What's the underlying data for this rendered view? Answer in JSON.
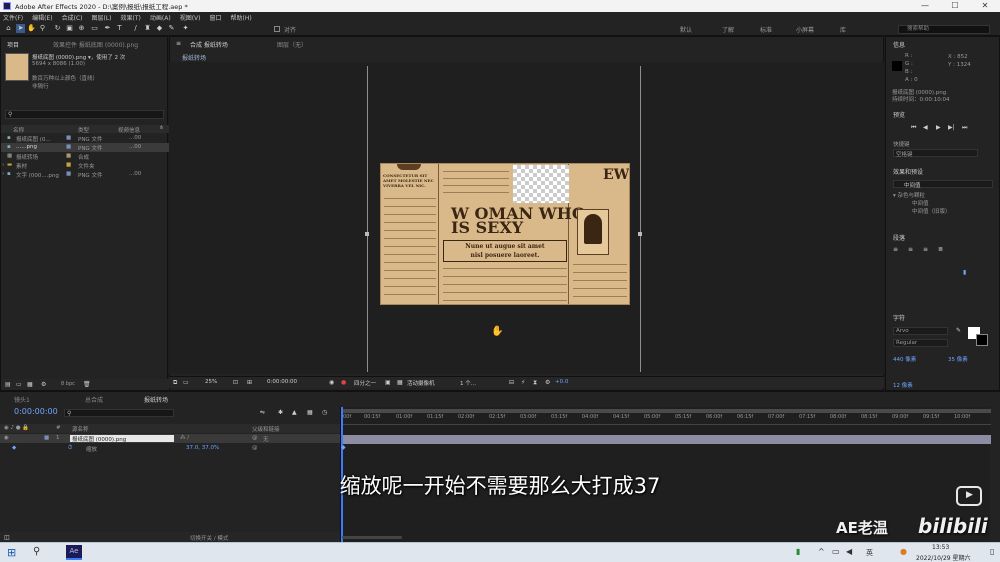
{
  "window": {
    "title": "Adobe After Effects 2020 - D:\\案例\\报纸\\报纸工程.aep *",
    "controls": [
      "—",
      "☐",
      "✕"
    ]
  },
  "menu": [
    "文件(F)",
    "编辑(E)",
    "合成(C)",
    "图层(L)",
    "效果(T)",
    "动画(A)",
    "视图(V)",
    "窗口",
    "帮助(H)"
  ],
  "toolbar": {
    "snap_label": "对齐",
    "workspaces": [
      "默认",
      "了解",
      "标准",
      "小屏幕",
      "库"
    ],
    "search_placeholder": "搜索帮助"
  },
  "project": {
    "tab_project": "项目",
    "tab_effects": "效果控件 报纸底图 (0000).png",
    "preview_name": "报纸底图 (0000).png ▾，使用了 2 次",
    "preview_size": "5694 x 8086 (1.00)",
    "preview_colors": "数百万种以上颜色（直线）",
    "preview_interp": "非隔行",
    "search_placeholder": "",
    "cols": [
      "名称",
      "类型",
      "视频信息"
    ],
    "items": [
      {
        "name": "报纸底图 (0...",
        "type": "PNG 文件",
        "info": "...00"
      },
      {
        "name": "......png",
        "type": "PNG 文件",
        "info": "...00"
      },
      {
        "name": "报纸转场",
        "type": "合成",
        "info": ""
      },
      {
        "name": "素材",
        "type": "文件夹",
        "info": ""
      },
      {
        "name": "文字 (000....png",
        "type": "PNG 文件",
        "info": "...00"
      }
    ],
    "bpc": "8 bpc"
  },
  "comp": {
    "tab": "合成 报纸转场",
    "layer_tab": "图层（无）",
    "sub_tab": "报纸转场",
    "zoom": "25%",
    "timecode": "0:00:00:00",
    "quality": "四分之一",
    "camera": "活动摄像机",
    "views": "1 个...",
    "exposure": "+0.0"
  },
  "newspaper": {
    "h_left": "CONSECTETUR SIT AMET MOLESTIE NEC VIVERRA VEL NIC.",
    "h_main1": "W OMAN WHO",
    "h_main2": "IS SEXY",
    "sub1": "Nune ut augue sit amet",
    "sub2": "nisl posuere laoreet.",
    "corner": "EWS"
  },
  "right": {
    "info": "信息",
    "info_x": "X : 852",
    "info_y": "Y : 1324",
    "info_r": "R :",
    "info_g": "G :",
    "info_b": "B :",
    "info_a": "A : 0",
    "info_layer": "报纸底图 (0000).png",
    "info_time": "持续时间：0:00:10:04",
    "preview": "预览",
    "shortcut": "快捷键",
    "shortcut_val": "空格键",
    "effects": "效果和预设",
    "effects_search": "中间值",
    "effects_group": "▾ 杂色与颗粒",
    "effects_item1": "中间值",
    "effects_item2": "中间值（旧版）",
    "align": "段落",
    "char": "字符",
    "font": "Arvo",
    "style": "Regular",
    "size": "440 像素",
    "leading": "35 像素",
    "kern": "12 像素"
  },
  "timeline": {
    "tabs": [
      "镜头1",
      "总合成",
      "报纸转场"
    ],
    "timecode": "0:00:00:00",
    "cols": [
      "#",
      "源名称",
      "父级和链接"
    ],
    "layer_num": "1",
    "layer_name": "报纸底图 (0000).png",
    "parent": "无",
    "prop_name": "缩放",
    "prop_value": "37.0, 37.0%",
    "ruler": [
      "00f",
      "00:15f",
      "01:00f",
      "01:15f",
      "02:00f",
      "02:15f",
      "03:00f",
      "03:15f",
      "04:00f",
      "04:15f",
      "05:00f",
      "05:15f",
      "06:00f",
      "06:15f",
      "07:00f",
      "07:15f",
      "08:00f",
      "08:15f",
      "09:00f",
      "09:15f",
      "10:00f"
    ],
    "footer": "切换开关 / 模式"
  },
  "subtitle": "缩放呢一开始不需要那么大打成37",
  "watermark": {
    "name": "AE老温",
    "brand": "bilibili"
  },
  "taskbar": {
    "time": "13:53",
    "date": "2022/10/29 星期六",
    "lang": "英"
  }
}
